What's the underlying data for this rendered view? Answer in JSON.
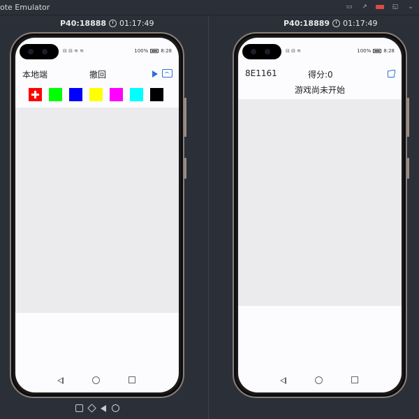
{
  "window": {
    "title": "ote Emulator",
    "controls": [
      "minimize-icon",
      "arrow-icon",
      "close-icon",
      "restore-icon",
      "more-icon"
    ]
  },
  "left_device": {
    "port": "P40:18888",
    "time": "01:17:49",
    "status_left": "⊟ ⊟ ≋ ≋",
    "battery": "100%",
    "clock": "8:28",
    "app": {
      "mode_label": "本地端",
      "undo_label": "撤回",
      "play_icon": "play-icon",
      "cast_icon": "cast-icon"
    },
    "colors": [
      {
        "name": "red",
        "hex": "#ff0000",
        "selected": true
      },
      {
        "name": "green",
        "hex": "#00ff00",
        "selected": false
      },
      {
        "name": "blue",
        "hex": "#0000ff",
        "selected": false
      },
      {
        "name": "yellow",
        "hex": "#ffff00",
        "selected": false
      },
      {
        "name": "magenta",
        "hex": "#ff00ff",
        "selected": false
      },
      {
        "name": "cyan",
        "hex": "#00ffff",
        "selected": false
      },
      {
        "name": "black",
        "hex": "#000000",
        "selected": false
      }
    ]
  },
  "right_device": {
    "port": "P40:18889",
    "time": "01:17:49",
    "status_left": "⊟ ⊟ ≋",
    "battery": "100%",
    "clock": "8:28",
    "app": {
      "room_id": "8E1161",
      "score": "得分:0",
      "status_message": "游戏尚未开始",
      "share_icon": "share-icon"
    }
  },
  "accent_color": "#2f6fd6"
}
